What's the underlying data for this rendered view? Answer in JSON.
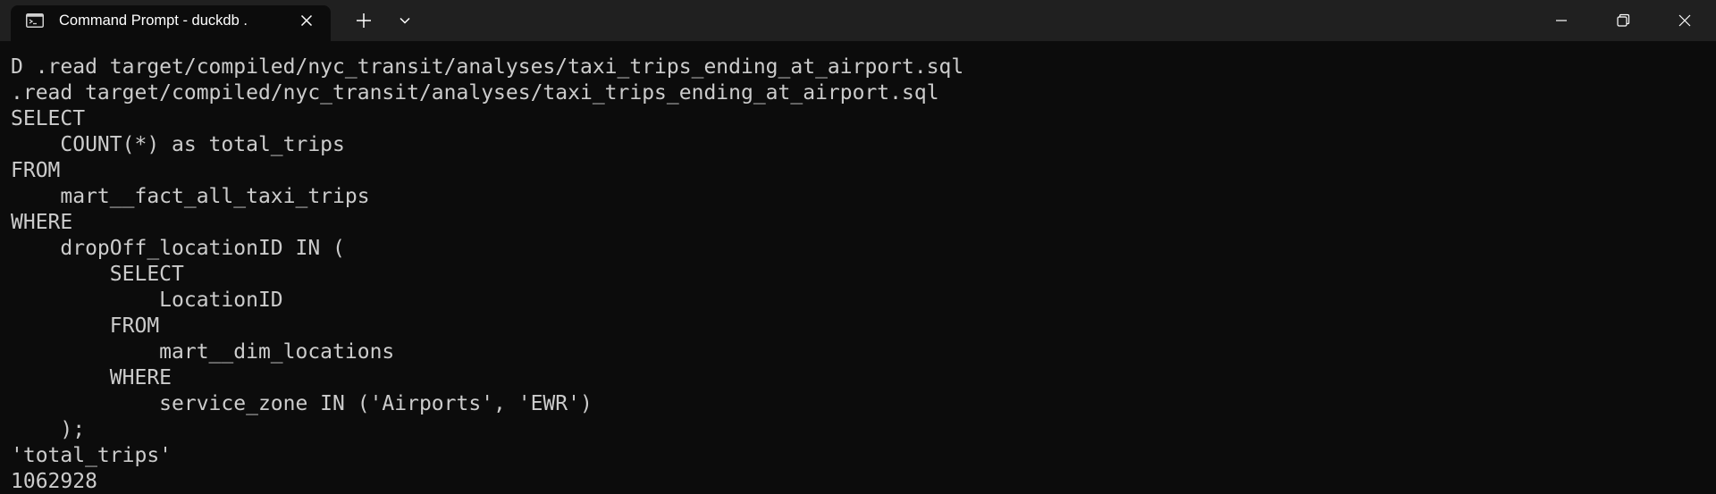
{
  "window": {
    "tab_title": "Command Prompt - duckdb .",
    "tab_icon": "terminal-icon",
    "new_tab_icon": "plus-icon",
    "dropdown_icon": "chevron-down-icon",
    "minimize_icon": "minimize-icon",
    "maximize_icon": "restore-icon",
    "close_icon": "close-icon"
  },
  "colors": {
    "background": "#0c0c0c",
    "titlebar": "#202020",
    "text": "#cccccc"
  },
  "terminal": {
    "lines": [
      "D .read target/compiled/nyc_transit/analyses/taxi_trips_ending_at_airport.sql",
      ".read target/compiled/nyc_transit/analyses/taxi_trips_ending_at_airport.sql",
      "SELECT",
      "    COUNT(*) as total_trips",
      "FROM",
      "    mart__fact_all_taxi_trips",
      "WHERE",
      "    dropOff_locationID IN (",
      "        SELECT",
      "            LocationID",
      "        FROM",
      "            mart__dim_locations",
      "        WHERE",
      "            service_zone IN ('Airports', 'EWR')",
      "    );",
      "'total_trips'",
      "1062928"
    ]
  }
}
